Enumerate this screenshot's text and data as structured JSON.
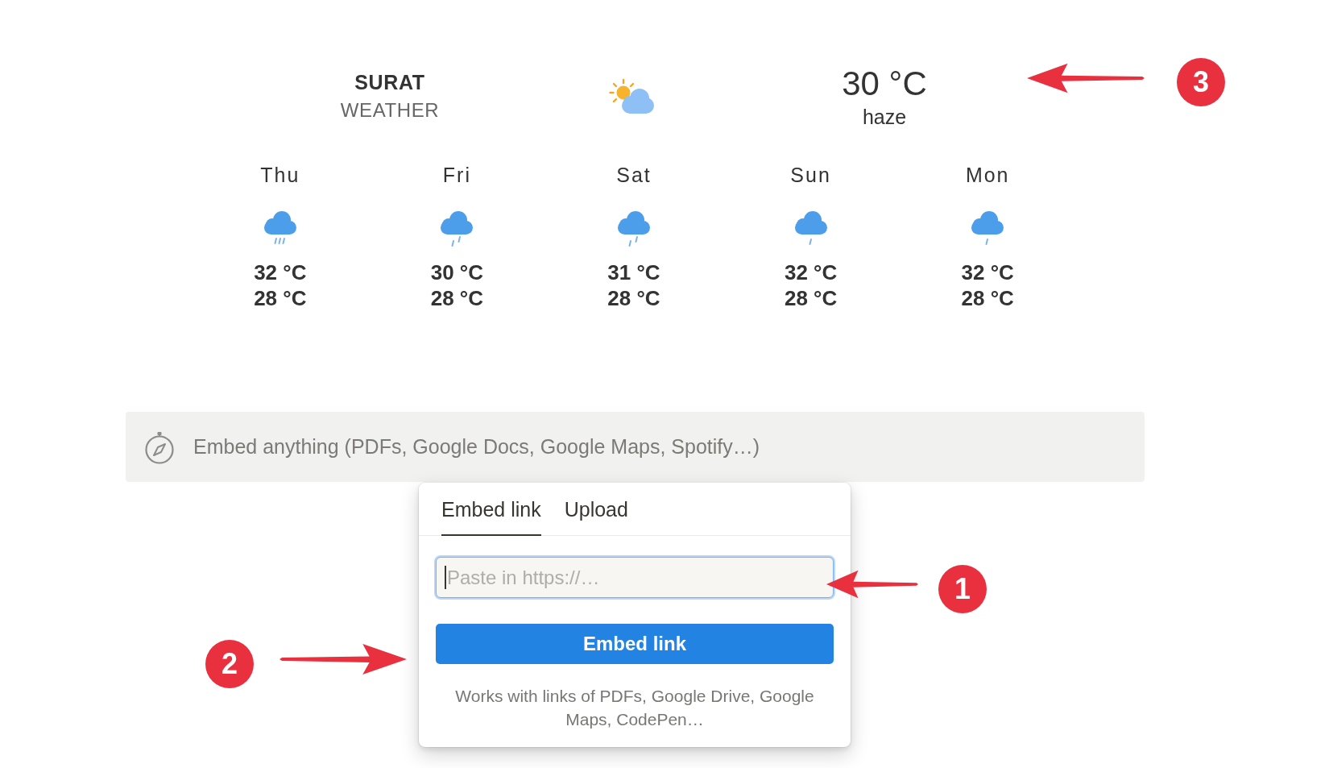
{
  "weather_widget": {
    "city": "SURAT",
    "subtitle": "WEATHER",
    "current": {
      "temperature": "30 °C",
      "condition": "haze",
      "callout": {
        "number": "3",
        "kind": "left"
      }
    },
    "forecast": [
      {
        "day": "Thu",
        "kind": "shower",
        "high": "32 °C",
        "low": "28 °C"
      },
      {
        "day": "Fri",
        "kind": "rain",
        "high": "30 °C",
        "low": "28 °C"
      },
      {
        "day": "Sat",
        "kind": "rain",
        "high": "31 °C",
        "low": "28 °C"
      },
      {
        "day": "Sun",
        "kind": "drizzle",
        "high": "32 °C",
        "low": "28 °C"
      },
      {
        "day": "Mon",
        "kind": "drizzle",
        "high": "32 °C",
        "low": "28 °C"
      }
    ]
  },
  "embed_block": {
    "prompt": "Embed anything (PDFs, Google Docs, Google Maps, Spotify…)"
  },
  "embed_popup": {
    "tabs": [
      {
        "label": "Embed link",
        "selected": true
      },
      {
        "label": "Upload",
        "selected": false
      }
    ],
    "link_field": {
      "placeholder": "Paste in https://…",
      "focused": true,
      "callout": {
        "number": "1",
        "kind": "left"
      }
    },
    "submit_button": "Embed link",
    "note": "Works with links of PDFs, Google Drive, Google Maps, CodePen…",
    "callout": {
      "number": "2",
      "kind": "right"
    }
  }
}
